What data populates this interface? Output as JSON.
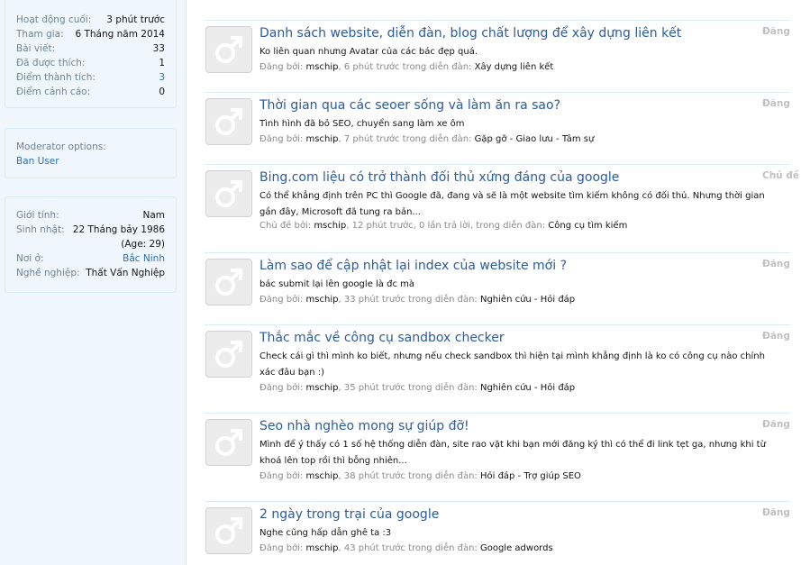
{
  "profile": {
    "stats": [
      {
        "label": "Hoạt động cuối:",
        "value": "3 phút trước",
        "link": false
      },
      {
        "label": "Tham gia:",
        "value": "6 Tháng năm 2014",
        "link": false
      },
      {
        "label": "Bài viết:",
        "value": "33",
        "link": false
      },
      {
        "label": "Đã được thích:",
        "value": "1",
        "link": false
      },
      {
        "label": "Điểm thành tích:",
        "value": "3",
        "link": true
      },
      {
        "label": "Điểm cảnh cáo:",
        "value": "0",
        "link": false
      }
    ],
    "moderator": {
      "title": "Moderator options:",
      "ban_user": "Ban User"
    },
    "info": [
      {
        "label": "Giới tính:",
        "value": "Nam",
        "link": false
      },
      {
        "label": "Sinh nhật:",
        "value": "22 Tháng bảy 1986",
        "link": false
      },
      {
        "label": "",
        "value": "(Age: 29)",
        "link": false
      },
      {
        "label": "Nơi ở:",
        "value": "Bắc Ninh",
        "link": true
      },
      {
        "label": "Nghề nghiệp:",
        "value": "Thất Vấn Nghiệp",
        "link": false
      }
    ]
  },
  "icons": {
    "avatar": "male-symbol-icon"
  },
  "colors": {
    "link": "#2b5c9e",
    "sidebar_bg": "#f0f7fc",
    "border": "#d7edfc"
  },
  "activity": [
    {
      "title": "Danh sách website, diễn đàn, blog chất lượng để xây dựng liên kết",
      "type": "Đăng",
      "snippet": "Ko liên quan nhưng Avatar của các bác đẹp quá.",
      "meta_prefix": "Đăng bởi: ",
      "user": "mschip",
      "meta_mid": ", 6 phút trước trong diễn đàn: ",
      "forum": "Xây dựng liên kết"
    },
    {
      "title": "Thời gian qua các seoer sống và làm ăn ra sao?",
      "type": "Đăng",
      "snippet": "Tình hình đã bỏ SEO, chuyển sang làm xe ôm",
      "meta_prefix": "Đăng bởi: ",
      "user": "mschip",
      "meta_mid": ", 7 phút trước trong diễn đàn: ",
      "forum": "Gặp gỡ - Giao lưu - Tâm sự"
    },
    {
      "title": "Bing.com liệu có trở thành đối thủ xứng đáng của google",
      "type": "Chủ đề",
      "snippet": "Có thể khẳng định trên PC thì Google đã, đang và sẽ là một website tìm kiếm không có đối thủ. Nhưng thời gian gần đây, Microsoft đã tung ra bản...",
      "meta_prefix": "Chủ đề bởi: ",
      "user": "mschip",
      "meta_mid": ", 12 phút trước, 0 lần trả lời, trong diễn đàn: ",
      "forum": "Công cụ tìm kiếm"
    },
    {
      "title": "Làm sao để cập nhật lại index của website mới ?",
      "type": "Đăng",
      "snippet": "bác submit lại lên google là đc mà",
      "meta_prefix": "Đăng bởi: ",
      "user": "mschip",
      "meta_mid": ", 33 phút trước trong diễn đàn: ",
      "forum": "Nghiên cứu - Hỏi đáp"
    },
    {
      "title": "Thắc mắc về công cụ sandbox checker",
      "type": "Đăng",
      "snippet": "Check cái gì thì mình ko biết, nhưng nếu check sandbox thì hiện tại mình khẳng định là ko có công cụ nào chính xác đâu bạn :)",
      "meta_prefix": "Đăng bởi: ",
      "user": "mschip",
      "meta_mid": ", 35 phút trước trong diễn đàn: ",
      "forum": "Nghiên cứu - Hỏi đáp"
    },
    {
      "title": "Seo nhà nghèo mong sự giúp đỡ!",
      "type": "Đăng",
      "snippet": "Mình để ý thấy có 1 số hệ thống diễn đàn, site rao vặt khi bạn mới đăng ký thì có thể đi link tẹt ga, nhưng khi từ khoá lên top rồi thì bỗng nhiên...",
      "meta_prefix": "Đăng bởi: ",
      "user": "mschip",
      "meta_mid": ", 38 phút trước trong diễn đàn: ",
      "forum": "Hỏi đáp - Trợ giúp SEO"
    },
    {
      "title": "2 ngày trong trại của google",
      "type": "Đăng",
      "snippet": "Nghe cũng hấp dẫn ghê ta :3",
      "meta_prefix": "Đăng bởi: ",
      "user": "mschip",
      "meta_mid": ", 43 phút trước trong diễn đàn: ",
      "forum": "Google adwords"
    }
  ]
}
